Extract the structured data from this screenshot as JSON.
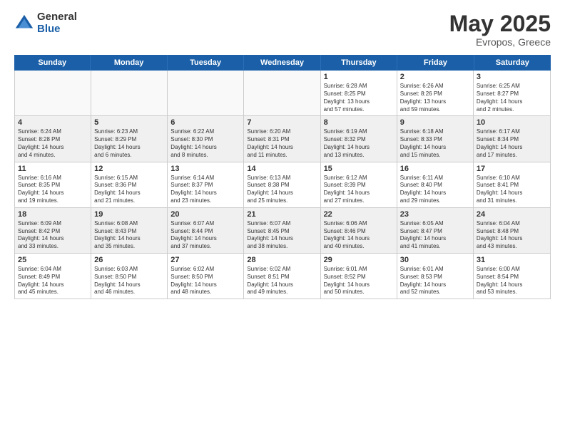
{
  "logo": {
    "general": "General",
    "blue": "Blue"
  },
  "title": "May 2025",
  "subtitle": "Evropos, Greece",
  "days": [
    "Sunday",
    "Monday",
    "Tuesday",
    "Wednesday",
    "Thursday",
    "Friday",
    "Saturday"
  ],
  "weeks": [
    [
      {
        "day": "",
        "empty": true
      },
      {
        "day": "",
        "empty": true
      },
      {
        "day": "",
        "empty": true
      },
      {
        "day": "",
        "empty": true
      },
      {
        "day": "1",
        "detail": "Sunrise: 6:28 AM\nSunset: 8:25 PM\nDaylight: 13 hours\nand 57 minutes."
      },
      {
        "day": "2",
        "detail": "Sunrise: 6:26 AM\nSunset: 8:26 PM\nDaylight: 13 hours\nand 59 minutes."
      },
      {
        "day": "3",
        "detail": "Sunrise: 6:25 AM\nSunset: 8:27 PM\nDaylight: 14 hours\nand 2 minutes."
      }
    ],
    [
      {
        "day": "4",
        "detail": "Sunrise: 6:24 AM\nSunset: 8:28 PM\nDaylight: 14 hours\nand 4 minutes."
      },
      {
        "day": "5",
        "detail": "Sunrise: 6:23 AM\nSunset: 8:29 PM\nDaylight: 14 hours\nand 6 minutes."
      },
      {
        "day": "6",
        "detail": "Sunrise: 6:22 AM\nSunset: 8:30 PM\nDaylight: 14 hours\nand 8 minutes."
      },
      {
        "day": "7",
        "detail": "Sunrise: 6:20 AM\nSunset: 8:31 PM\nDaylight: 14 hours\nand 11 minutes."
      },
      {
        "day": "8",
        "detail": "Sunrise: 6:19 AM\nSunset: 8:32 PM\nDaylight: 14 hours\nand 13 minutes."
      },
      {
        "day": "9",
        "detail": "Sunrise: 6:18 AM\nSunset: 8:33 PM\nDaylight: 14 hours\nand 15 minutes."
      },
      {
        "day": "10",
        "detail": "Sunrise: 6:17 AM\nSunset: 8:34 PM\nDaylight: 14 hours\nand 17 minutes."
      }
    ],
    [
      {
        "day": "11",
        "detail": "Sunrise: 6:16 AM\nSunset: 8:35 PM\nDaylight: 14 hours\nand 19 minutes."
      },
      {
        "day": "12",
        "detail": "Sunrise: 6:15 AM\nSunset: 8:36 PM\nDaylight: 14 hours\nand 21 minutes."
      },
      {
        "day": "13",
        "detail": "Sunrise: 6:14 AM\nSunset: 8:37 PM\nDaylight: 14 hours\nand 23 minutes."
      },
      {
        "day": "14",
        "detail": "Sunrise: 6:13 AM\nSunset: 8:38 PM\nDaylight: 14 hours\nand 25 minutes."
      },
      {
        "day": "15",
        "detail": "Sunrise: 6:12 AM\nSunset: 8:39 PM\nDaylight: 14 hours\nand 27 minutes."
      },
      {
        "day": "16",
        "detail": "Sunrise: 6:11 AM\nSunset: 8:40 PM\nDaylight: 14 hours\nand 29 minutes."
      },
      {
        "day": "17",
        "detail": "Sunrise: 6:10 AM\nSunset: 8:41 PM\nDaylight: 14 hours\nand 31 minutes."
      }
    ],
    [
      {
        "day": "18",
        "detail": "Sunrise: 6:09 AM\nSunset: 8:42 PM\nDaylight: 14 hours\nand 33 minutes."
      },
      {
        "day": "19",
        "detail": "Sunrise: 6:08 AM\nSunset: 8:43 PM\nDaylight: 14 hours\nand 35 minutes."
      },
      {
        "day": "20",
        "detail": "Sunrise: 6:07 AM\nSunset: 8:44 PM\nDaylight: 14 hours\nand 37 minutes."
      },
      {
        "day": "21",
        "detail": "Sunrise: 6:07 AM\nSunset: 8:45 PM\nDaylight: 14 hours\nand 38 minutes."
      },
      {
        "day": "22",
        "detail": "Sunrise: 6:06 AM\nSunset: 8:46 PM\nDaylight: 14 hours\nand 40 minutes."
      },
      {
        "day": "23",
        "detail": "Sunrise: 6:05 AM\nSunset: 8:47 PM\nDaylight: 14 hours\nand 41 minutes."
      },
      {
        "day": "24",
        "detail": "Sunrise: 6:04 AM\nSunset: 8:48 PM\nDaylight: 14 hours\nand 43 minutes."
      }
    ],
    [
      {
        "day": "25",
        "detail": "Sunrise: 6:04 AM\nSunset: 8:49 PM\nDaylight: 14 hours\nand 45 minutes."
      },
      {
        "day": "26",
        "detail": "Sunrise: 6:03 AM\nSunset: 8:50 PM\nDaylight: 14 hours\nand 46 minutes."
      },
      {
        "day": "27",
        "detail": "Sunrise: 6:02 AM\nSunset: 8:50 PM\nDaylight: 14 hours\nand 48 minutes."
      },
      {
        "day": "28",
        "detail": "Sunrise: 6:02 AM\nSunset: 8:51 PM\nDaylight: 14 hours\nand 49 minutes."
      },
      {
        "day": "29",
        "detail": "Sunrise: 6:01 AM\nSunset: 8:52 PM\nDaylight: 14 hours\nand 50 minutes."
      },
      {
        "day": "30",
        "detail": "Sunrise: 6:01 AM\nSunset: 8:53 PM\nDaylight: 14 hours\nand 52 minutes."
      },
      {
        "day": "31",
        "detail": "Sunrise: 6:00 AM\nSunset: 8:54 PM\nDaylight: 14 hours\nand 53 minutes."
      }
    ]
  ]
}
